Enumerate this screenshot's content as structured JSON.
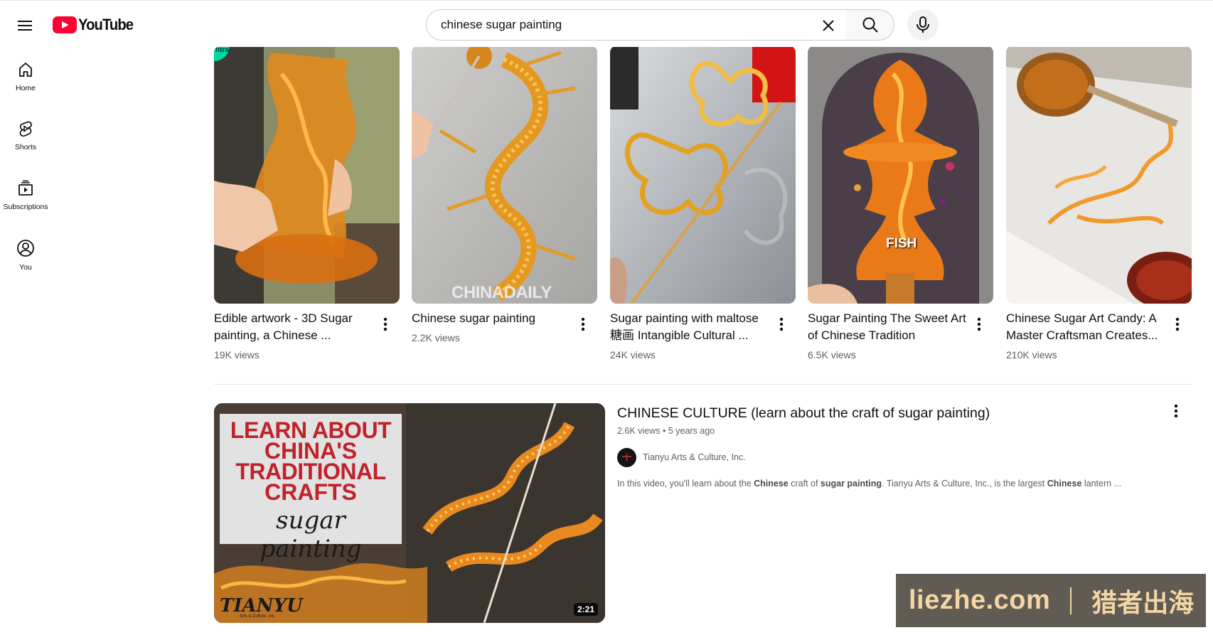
{
  "header": {
    "logo_text": "YouTube",
    "search_value": "chinese sugar painting"
  },
  "sidebar": {
    "items": [
      {
        "label": "Home",
        "icon": "home-icon"
      },
      {
        "label": "Shorts",
        "icon": "shorts-icon"
      },
      {
        "label": "Subscriptions",
        "icon": "subscriptions-icon"
      },
      {
        "label": "You",
        "icon": "you-icon"
      }
    ]
  },
  "shorts": [
    {
      "title": "Edible artwork - 3D Sugar painting, a Chinese ...",
      "views": "19K views",
      "badge": "ntral"
    },
    {
      "title": "Chinese sugar painting",
      "views": "2.2K views",
      "overlay": "CHINADAILY"
    },
    {
      "title": "Sugar painting with maltose 糖画 Intangible Cultural ...",
      "views": "24K views"
    },
    {
      "title": "Sugar Painting The Sweet Art of Chinese Tradition",
      "views": "6.5K views",
      "overlay": "FISH"
    },
    {
      "title": "Chinese Sugar Art Candy: A Master Craftsman Creates...",
      "views": "210K views"
    }
  ],
  "result": {
    "title": "CHINESE CULTURE (learn about the craft of sugar painting)",
    "views": "2.6K views",
    "age": "5 years ago",
    "channel": "Tianyu Arts & Culture, Inc.",
    "desc_1": "In this video, you'll learn about the ",
    "desc_b1": "Chinese",
    "desc_2": " craft of ",
    "desc_b2": "sugar painting",
    "desc_3": ". Tianyu Arts & Culture, Inc., is the largest ",
    "desc_b3": "Chinese",
    "desc_4": " lantern ...",
    "duration": "2:21",
    "thumb_line1": "LEARN ABOUT",
    "thumb_line2": "CHINA'S",
    "thumb_line3": "TRADITIONAL",
    "thumb_line4": "CRAFTS",
    "thumb_script": "sugar painting",
    "thumb_brand": "TIANYU",
    "thumb_brand_sub": "Arts & Culture, Inc."
  },
  "watermark": {
    "left": "liezhe.com",
    "right": "猎者出海"
  },
  "colors": {
    "brand_red": "#ff0033",
    "text_secondary": "#606060",
    "watermark_text": "#f3d6a6"
  }
}
